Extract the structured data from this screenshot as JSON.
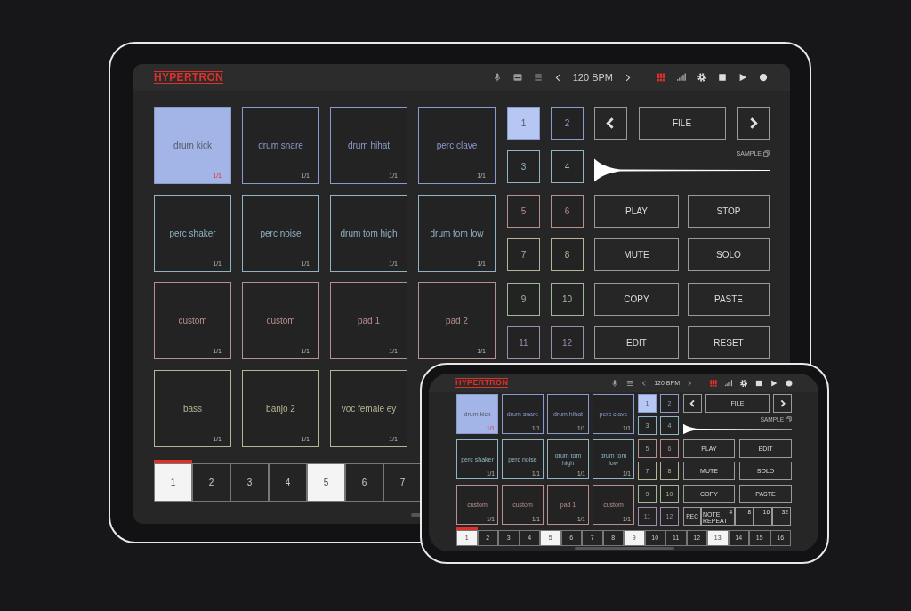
{
  "tablet": {
    "header": {
      "logo": "HYPERTRON",
      "left_icons": [
        {
          "kind": "mic"
        },
        {
          "kind": "panel"
        },
        {
          "kind": "menu"
        }
      ],
      "bpm": "120 BPM",
      "right_icons": [
        {
          "kind": "grid",
          "on": true
        },
        {
          "kind": "signal"
        },
        {
          "kind": "gear"
        },
        {
          "kind": "stop"
        },
        {
          "kind": "play"
        },
        {
          "kind": "record"
        }
      ]
    },
    "pads": [
      {
        "name": "drum kick",
        "count": "1/1",
        "selected": true,
        "color": "#8a9acc"
      },
      {
        "name": "drum snare",
        "count": "1/1",
        "selected": false,
        "color": "#8a9acc"
      },
      {
        "name": "drum hihat",
        "count": "1/1",
        "selected": false,
        "color": "#8a9acc"
      },
      {
        "name": "perc clave",
        "count": "1/1",
        "selected": false,
        "color": "#8a9acc"
      },
      {
        "name": "perc shaker",
        "count": "1/1",
        "selected": false,
        "color": "#8fb4c4"
      },
      {
        "name": "perc noise",
        "count": "1/1",
        "selected": false,
        "color": "#8fb4c4"
      },
      {
        "name": "drum tom high",
        "count": "1/1",
        "selected": false,
        "color": "#8fb4c4"
      },
      {
        "name": "drum tom low",
        "count": "1/1",
        "selected": false,
        "color": "#8fb4c4"
      },
      {
        "name": "custom",
        "count": "1/1",
        "selected": false,
        "color": "#b88f8f"
      },
      {
        "name": "custom",
        "count": "1/1",
        "selected": false,
        "color": "#b88f8f"
      },
      {
        "name": "pad 1",
        "count": "1/1",
        "selected": false,
        "color": "#b88f8f"
      },
      {
        "name": "pad 2",
        "count": "1/1",
        "selected": false,
        "color": "#b88f8f"
      },
      {
        "name": "bass",
        "count": "1/1",
        "selected": false,
        "color": "#b6b493"
      },
      {
        "name": "banjo 2",
        "count": "1/1",
        "selected": false,
        "color": "#b6b493"
      },
      {
        "name": "voc female ey",
        "count": "1/1",
        "selected": false,
        "color": "#b6b493"
      }
    ],
    "slices": [
      {
        "label": "1",
        "selected": true,
        "color": "#8a9acc"
      },
      {
        "label": "2",
        "selected": false,
        "color": "#8a9acc"
      },
      {
        "label": "3",
        "selected": false,
        "color": "#8fb4c4"
      },
      {
        "label": "4",
        "selected": false,
        "color": "#8fb4c4"
      },
      {
        "label": "5",
        "selected": false,
        "color": "#b88f8f"
      },
      {
        "label": "6",
        "selected": false,
        "color": "#b88f8f"
      },
      {
        "label": "7",
        "selected": false,
        "color": "#b6b493"
      },
      {
        "label": "8",
        "selected": false,
        "color": "#b6b493"
      },
      {
        "label": "9",
        "selected": false,
        "color": "#9fb89a"
      },
      {
        "label": "10",
        "selected": false,
        "color": "#9fb89a"
      },
      {
        "label": "11",
        "selected": false,
        "color": "#a08aae"
      },
      {
        "label": "12",
        "selected": false,
        "color": "#a08aae"
      }
    ],
    "file_button": "FILE",
    "sample_label": "SAMPLE",
    "actions": [
      "PLAY",
      "STOP",
      "MUTE",
      "SOLO",
      "COPY",
      "PASTE",
      "EDIT",
      "RESET"
    ],
    "steps": [
      {
        "label": "1",
        "selected": true,
        "playing": true
      },
      {
        "label": "2",
        "selected": false,
        "playing": false
      },
      {
        "label": "3",
        "selected": false,
        "playing": false
      },
      {
        "label": "4",
        "selected": false,
        "playing": false
      },
      {
        "label": "5",
        "selected": true,
        "playing": false
      },
      {
        "label": "6",
        "selected": false,
        "playing": false
      },
      {
        "label": "7",
        "selected": false,
        "playing": false
      }
    ]
  },
  "phone": {
    "header": {
      "logo": "HYPERTRON",
      "left_icons": [
        {
          "kind": "mic"
        },
        {
          "kind": "menu"
        }
      ],
      "bpm": "120 BPM",
      "right_icons": [
        {
          "kind": "grid",
          "on": true
        },
        {
          "kind": "signal"
        },
        {
          "kind": "gear"
        },
        {
          "kind": "stop"
        },
        {
          "kind": "play"
        },
        {
          "kind": "record"
        }
      ]
    },
    "pads": [
      {
        "name": "drum kick",
        "count": "1/1",
        "selected": true,
        "color": "#8a9acc"
      },
      {
        "name": "drum snare",
        "count": "1/1",
        "selected": false,
        "color": "#8a9acc"
      },
      {
        "name": "drum hihat",
        "count": "1/1",
        "selected": false,
        "color": "#8a9acc"
      },
      {
        "name": "perc clave",
        "count": "1/1",
        "selected": false,
        "color": "#8a9acc"
      },
      {
        "name": "perc shaker",
        "count": "1/1",
        "selected": false,
        "color": "#8fb4c4"
      },
      {
        "name": "perc noise",
        "count": "1/1",
        "selected": false,
        "color": "#8fb4c4"
      },
      {
        "name": "drum tom high",
        "count": "1/1",
        "selected": false,
        "color": "#8fb4c4"
      },
      {
        "name": "drum tom low",
        "count": "1/1",
        "selected": false,
        "color": "#8fb4c4"
      },
      {
        "name": "custom",
        "count": "1/1",
        "selected": false,
        "color": "#b88f8f"
      },
      {
        "name": "custom",
        "count": "1/1",
        "selected": false,
        "color": "#b88f8f"
      },
      {
        "name": "pad 1",
        "count": "1/1",
        "selected": false,
        "color": "#b88f8f"
      },
      {
        "name": "custom",
        "count": "1/1",
        "selected": false,
        "color": "#b88f8f"
      }
    ],
    "slices": [
      {
        "label": "1",
        "selected": true,
        "color": "#8a9acc"
      },
      {
        "label": "2",
        "selected": false,
        "color": "#8a9acc"
      },
      {
        "label": "3",
        "selected": false,
        "color": "#8fb4c4"
      },
      {
        "label": "4",
        "selected": false,
        "color": "#8fb4c4"
      },
      {
        "label": "5",
        "selected": false,
        "color": "#b88f8f"
      },
      {
        "label": "6",
        "selected": false,
        "color": "#b88f8f"
      },
      {
        "label": "7",
        "selected": false,
        "color": "#b6b493"
      },
      {
        "label": "8",
        "selected": false,
        "color": "#b6b493"
      },
      {
        "label": "9",
        "selected": false,
        "color": "#9fb89a"
      },
      {
        "label": "10",
        "selected": false,
        "color": "#9fb89a"
      },
      {
        "label": "11",
        "selected": false,
        "color": "#a08aae"
      },
      {
        "label": "12",
        "selected": false,
        "color": "#a08aae"
      }
    ],
    "file_button": "FILE",
    "sample_label": "SAMPLE",
    "actions": [
      "PLAY",
      "EDIT",
      "MUTE",
      "SOLO",
      "COPY",
      "PASTE"
    ],
    "repeat": [
      {
        "label": "REC"
      },
      {
        "label": "NOTE REPEAT",
        "value": "4"
      },
      {
        "value": "8"
      },
      {
        "value": "16"
      },
      {
        "value": "32"
      }
    ],
    "steps": [
      {
        "label": "1",
        "selected": true,
        "playing": true
      },
      {
        "label": "2",
        "selected": false,
        "playing": false
      },
      {
        "label": "3",
        "selected": false,
        "playing": false
      },
      {
        "label": "4",
        "selected": false,
        "playing": false
      },
      {
        "label": "5",
        "selected": true,
        "playing": false
      },
      {
        "label": "6",
        "selected": false,
        "playing": false
      },
      {
        "label": "7",
        "selected": false,
        "playing": false
      },
      {
        "label": "8",
        "selected": false,
        "playing": false
      },
      {
        "label": "9",
        "selected": true,
        "playing": false
      },
      {
        "label": "10",
        "selected": false,
        "playing": false
      },
      {
        "label": "11",
        "selected": false,
        "playing": false
      },
      {
        "label": "12",
        "selected": false,
        "playing": false
      },
      {
        "label": "13",
        "selected": true,
        "playing": false
      },
      {
        "label": "14",
        "selected": false,
        "playing": false
      },
      {
        "label": "15",
        "selected": false,
        "playing": false
      },
      {
        "label": "16",
        "selected": false,
        "playing": false
      }
    ]
  }
}
